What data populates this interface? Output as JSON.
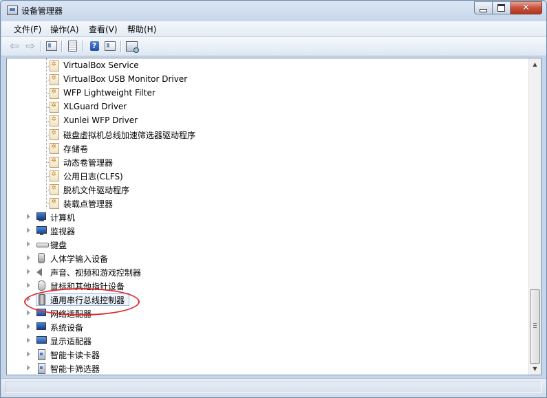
{
  "window": {
    "title": "设备管理器"
  },
  "caption_buttons": {
    "minimize_icon": "minimize-icon",
    "maximize_icon": "maximize-icon",
    "close_icon": "close-icon",
    "close_glyph": "✕"
  },
  "menu": {
    "items": [
      "文件(F)",
      "操作(A)",
      "查看(V)",
      "帮助(H)"
    ]
  },
  "toolbar": {
    "buttons": [
      {
        "name": "back-button",
        "icon": "back-arrow-icon",
        "glyph": "⇦"
      },
      {
        "name": "forward-button",
        "icon": "forward-arrow-icon",
        "glyph": "⇨"
      },
      {
        "name": "show-hide-console-tree-button",
        "icon": "console-tree-icon"
      },
      {
        "name": "properties-button",
        "icon": "properties-icon"
      },
      {
        "name": "help-button",
        "icon": "help-icon",
        "glyph": "?"
      },
      {
        "name": "action-pane-button",
        "icon": "action-pane-icon"
      },
      {
        "name": "scan-hardware-button",
        "icon": "scan-hardware-icon"
      }
    ]
  },
  "tree": {
    "drivers": [
      "VirtualBox Service",
      "VirtualBox USB Monitor Driver",
      "WFP Lightweight Filter",
      "XLGuard Driver",
      "Xunlei WFP Driver",
      "磁盘虚拟机总线加速筛选器驱动程序",
      "存储卷",
      "动态卷管理器",
      "公用日志(CLFS)",
      "脱机文件驱动程序",
      "装载点管理器"
    ],
    "categories": [
      {
        "label": "计算机",
        "icon": "computer-icon"
      },
      {
        "label": "监视器",
        "icon": "monitor-icon"
      },
      {
        "label": "键盘",
        "icon": "keyboard-icon"
      },
      {
        "label": "人体学输入设备",
        "icon": "hid-icon"
      },
      {
        "label": "声音、视频和游戏控制器",
        "icon": "speaker-icon"
      },
      {
        "label": "鼠标和其他指针设备",
        "icon": "mouse-icon"
      },
      {
        "label": "通用串行总线控制器",
        "icon": "usb-icon",
        "selected": true
      },
      {
        "label": "网络适配器",
        "icon": "network-adapter-icon"
      },
      {
        "label": "系统设备",
        "icon": "system-device-icon"
      },
      {
        "label": "显示适配器",
        "icon": "display-adapter-icon"
      },
      {
        "label": "智能卡读卡器",
        "icon": "smart-card-reader-icon"
      },
      {
        "label": "智能卡筛选器",
        "icon": "smart-card-filter-icon"
      }
    ]
  },
  "annotation": {
    "color": "#e0292b"
  },
  "scrollbar": {
    "up_glyph": "▲",
    "down_glyph": "▼"
  },
  "status": {
    "text": ""
  }
}
